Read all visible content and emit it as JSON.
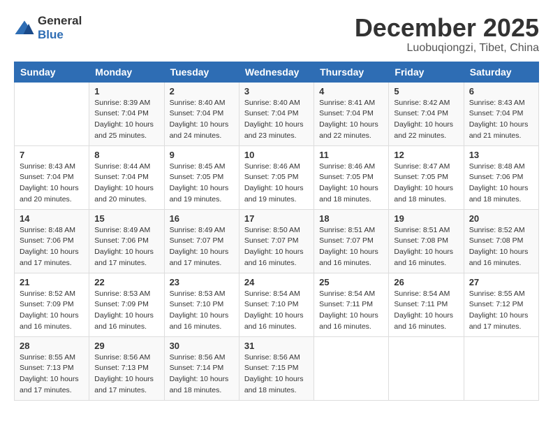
{
  "logo": {
    "general": "General",
    "blue": "Blue"
  },
  "title": "December 2025",
  "subtitle": "Luobuqiongzi, Tibet, China",
  "weekdays": [
    "Sunday",
    "Monday",
    "Tuesday",
    "Wednesday",
    "Thursday",
    "Friday",
    "Saturday"
  ],
  "weeks": [
    [
      {
        "day": "",
        "info": ""
      },
      {
        "day": "1",
        "info": "Sunrise: 8:39 AM\nSunset: 7:04 PM\nDaylight: 10 hours\nand 25 minutes."
      },
      {
        "day": "2",
        "info": "Sunrise: 8:40 AM\nSunset: 7:04 PM\nDaylight: 10 hours\nand 24 minutes."
      },
      {
        "day": "3",
        "info": "Sunrise: 8:40 AM\nSunset: 7:04 PM\nDaylight: 10 hours\nand 23 minutes."
      },
      {
        "day": "4",
        "info": "Sunrise: 8:41 AM\nSunset: 7:04 PM\nDaylight: 10 hours\nand 22 minutes."
      },
      {
        "day": "5",
        "info": "Sunrise: 8:42 AM\nSunset: 7:04 PM\nDaylight: 10 hours\nand 22 minutes."
      },
      {
        "day": "6",
        "info": "Sunrise: 8:43 AM\nSunset: 7:04 PM\nDaylight: 10 hours\nand 21 minutes."
      }
    ],
    [
      {
        "day": "7",
        "info": "Sunrise: 8:43 AM\nSunset: 7:04 PM\nDaylight: 10 hours\nand 20 minutes."
      },
      {
        "day": "8",
        "info": "Sunrise: 8:44 AM\nSunset: 7:04 PM\nDaylight: 10 hours\nand 20 minutes."
      },
      {
        "day": "9",
        "info": "Sunrise: 8:45 AM\nSunset: 7:05 PM\nDaylight: 10 hours\nand 19 minutes."
      },
      {
        "day": "10",
        "info": "Sunrise: 8:46 AM\nSunset: 7:05 PM\nDaylight: 10 hours\nand 19 minutes."
      },
      {
        "day": "11",
        "info": "Sunrise: 8:46 AM\nSunset: 7:05 PM\nDaylight: 10 hours\nand 18 minutes."
      },
      {
        "day": "12",
        "info": "Sunrise: 8:47 AM\nSunset: 7:05 PM\nDaylight: 10 hours\nand 18 minutes."
      },
      {
        "day": "13",
        "info": "Sunrise: 8:48 AM\nSunset: 7:06 PM\nDaylight: 10 hours\nand 18 minutes."
      }
    ],
    [
      {
        "day": "14",
        "info": "Sunrise: 8:48 AM\nSunset: 7:06 PM\nDaylight: 10 hours\nand 17 minutes."
      },
      {
        "day": "15",
        "info": "Sunrise: 8:49 AM\nSunset: 7:06 PM\nDaylight: 10 hours\nand 17 minutes."
      },
      {
        "day": "16",
        "info": "Sunrise: 8:49 AM\nSunset: 7:07 PM\nDaylight: 10 hours\nand 17 minutes."
      },
      {
        "day": "17",
        "info": "Sunrise: 8:50 AM\nSunset: 7:07 PM\nDaylight: 10 hours\nand 16 minutes."
      },
      {
        "day": "18",
        "info": "Sunrise: 8:51 AM\nSunset: 7:07 PM\nDaylight: 10 hours\nand 16 minutes."
      },
      {
        "day": "19",
        "info": "Sunrise: 8:51 AM\nSunset: 7:08 PM\nDaylight: 10 hours\nand 16 minutes."
      },
      {
        "day": "20",
        "info": "Sunrise: 8:52 AM\nSunset: 7:08 PM\nDaylight: 10 hours\nand 16 minutes."
      }
    ],
    [
      {
        "day": "21",
        "info": "Sunrise: 8:52 AM\nSunset: 7:09 PM\nDaylight: 10 hours\nand 16 minutes."
      },
      {
        "day": "22",
        "info": "Sunrise: 8:53 AM\nSunset: 7:09 PM\nDaylight: 10 hours\nand 16 minutes."
      },
      {
        "day": "23",
        "info": "Sunrise: 8:53 AM\nSunset: 7:10 PM\nDaylight: 10 hours\nand 16 minutes."
      },
      {
        "day": "24",
        "info": "Sunrise: 8:54 AM\nSunset: 7:10 PM\nDaylight: 10 hours\nand 16 minutes."
      },
      {
        "day": "25",
        "info": "Sunrise: 8:54 AM\nSunset: 7:11 PM\nDaylight: 10 hours\nand 16 minutes."
      },
      {
        "day": "26",
        "info": "Sunrise: 8:54 AM\nSunset: 7:11 PM\nDaylight: 10 hours\nand 16 minutes."
      },
      {
        "day": "27",
        "info": "Sunrise: 8:55 AM\nSunset: 7:12 PM\nDaylight: 10 hours\nand 17 minutes."
      }
    ],
    [
      {
        "day": "28",
        "info": "Sunrise: 8:55 AM\nSunset: 7:13 PM\nDaylight: 10 hours\nand 17 minutes."
      },
      {
        "day": "29",
        "info": "Sunrise: 8:56 AM\nSunset: 7:13 PM\nDaylight: 10 hours\nand 17 minutes."
      },
      {
        "day": "30",
        "info": "Sunrise: 8:56 AM\nSunset: 7:14 PM\nDaylight: 10 hours\nand 18 minutes."
      },
      {
        "day": "31",
        "info": "Sunrise: 8:56 AM\nSunset: 7:15 PM\nDaylight: 10 hours\nand 18 minutes."
      },
      {
        "day": "",
        "info": ""
      },
      {
        "day": "",
        "info": ""
      },
      {
        "day": "",
        "info": ""
      }
    ]
  ]
}
